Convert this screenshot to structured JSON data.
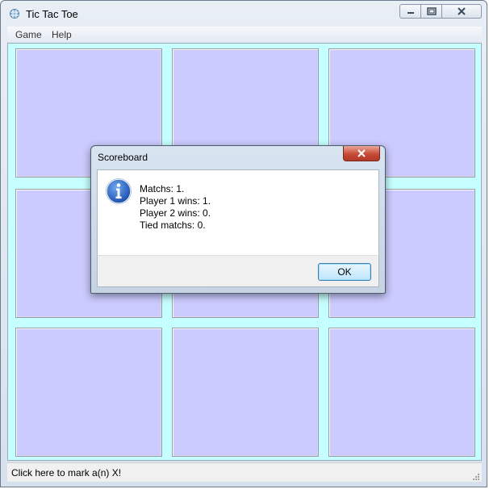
{
  "window": {
    "title": "Tic Tac Toe",
    "menu": [
      "Game",
      "Help"
    ],
    "status_text": "Click here to mark a(n) X!"
  },
  "board": {
    "cell_color": "#cccbff",
    "background_color": "#c6ffff",
    "cells": [
      "",
      "",
      "",
      "",
      "",
      "",
      "",
      "",
      ""
    ]
  },
  "dialog": {
    "title": "Scoreboard",
    "icon": "info-icon",
    "lines": [
      "Matchs: 1.",
      "Player 1 wins: 1.",
      "Player 2 wins: 0.",
      "Tied matchs: 0."
    ],
    "ok_label": "OK"
  }
}
